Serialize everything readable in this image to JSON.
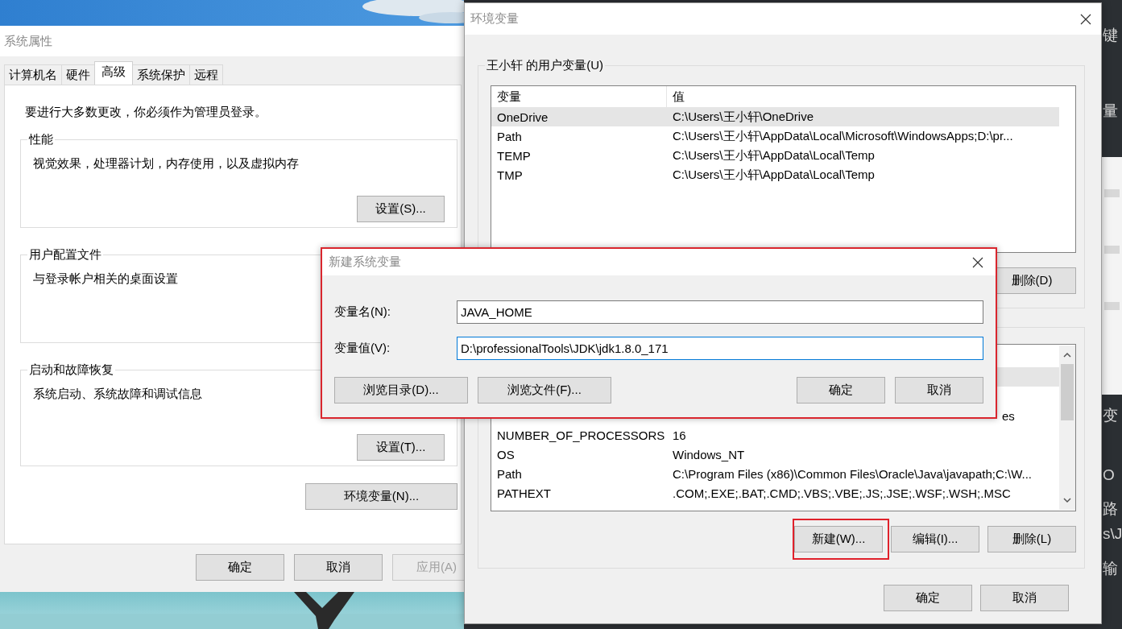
{
  "background_window": {
    "texts": [
      "键",
      "量",
      "变",
      "O",
      "路",
      "s\\J",
      "输"
    ]
  },
  "system_properties": {
    "title": "系统属性",
    "tabs": [
      {
        "label": "计算机名",
        "selected": false
      },
      {
        "label": "硬件",
        "selected": false
      },
      {
        "label": "高级",
        "selected": true
      },
      {
        "label": "系统保护",
        "selected": false
      },
      {
        "label": "远程",
        "selected": false
      }
    ],
    "notice": "要进行大多数更改，你必须作为管理员登录。",
    "groups": [
      {
        "title": "性能",
        "text": "视觉效果，处理器计划，内存使用，以及虚拟内存",
        "button": "设置(S)..."
      },
      {
        "title": "用户配置文件",
        "text": "与登录帐户相关的桌面设置"
      },
      {
        "title": "启动和故障恢复",
        "text": "系统启动、系统故障和调试信息",
        "button": "设置(T)..."
      }
    ],
    "env_button": "环境变量(N)...",
    "buttons": [
      {
        "label": "确定",
        "disabled": false
      },
      {
        "label": "取消",
        "disabled": false
      },
      {
        "label": "应用(A)",
        "disabled": true
      }
    ]
  },
  "environment_variables": {
    "title": "环境变量",
    "user_group": {
      "title": "王小轩 的用户变量(U)",
      "columns": [
        "变量",
        "值"
      ],
      "rows": [
        {
          "name": "OneDrive",
          "value": "C:\\Users\\王小轩\\OneDrive",
          "selected": true
        },
        {
          "name": "Path",
          "value": "C:\\Users\\王小轩\\AppData\\Local\\Microsoft\\WindowsApps;D:\\pr...",
          "selected": false
        },
        {
          "name": "TEMP",
          "value": "C:\\Users\\王小轩\\AppData\\Local\\Temp",
          "selected": false
        },
        {
          "name": "TMP",
          "value": "C:\\Users\\王小轩\\AppData\\Local\\Temp",
          "selected": false
        }
      ],
      "buttons": [
        {
          "label": "删除(D)",
          "highlighted": false
        }
      ]
    },
    "system_group": {
      "rows": [
        {
          "selected": true
        },
        {
          "selected": false
        },
        {
          "kind": "tail",
          "value": "es",
          "selected": false
        },
        {
          "name": "NUMBER_OF_PROCESSORS",
          "value": "16",
          "selected": false
        },
        {
          "name": "OS",
          "value": "Windows_NT",
          "selected": false
        },
        {
          "name": "Path",
          "value": "C:\\Program Files (x86)\\Common Files\\Oracle\\Java\\javapath;C:\\W...",
          "selected": false
        },
        {
          "name": "PATHEXT",
          "value": ".COM;.EXE;.BAT;.CMD;.VBS;.VBE;.JS;.JSE;.WSF;.WSH;.MSC",
          "selected": false
        }
      ],
      "buttons": [
        {
          "label": "新建(W)...",
          "highlighted": true
        },
        {
          "label": "编辑(I)...",
          "highlighted": false
        },
        {
          "label": "删除(L)",
          "highlighted": false
        }
      ]
    },
    "buttons": [
      "确定",
      "取消"
    ]
  },
  "new_variable_dialog": {
    "title": "新建系统变量",
    "fields": [
      {
        "label": "变量名(N):",
        "value": "JAVA_HOME",
        "focused": false
      },
      {
        "label": "变量值(V):",
        "value": "D:\\professionalTools\\JDK\\jdk1.8.0_171",
        "focused": true
      }
    ],
    "browse_buttons": [
      "浏览目录(D)...",
      "浏览文件(F)..."
    ],
    "buttons": [
      "确定",
      "取消"
    ]
  }
}
